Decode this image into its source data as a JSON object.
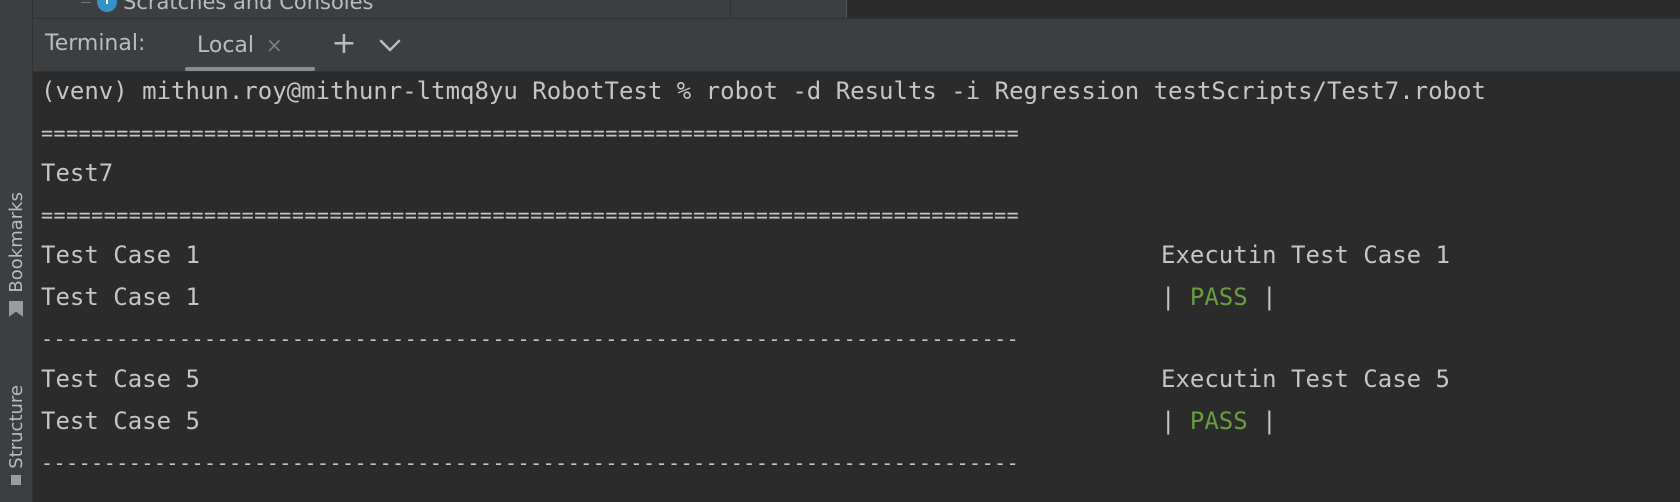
{
  "project_tree": {
    "item_label": "Scratches and Consoles",
    "item_icon": "scratches-clock-icon"
  },
  "left_strip": {
    "bookmarks_label": "Bookmarks",
    "structure_label": "Structure"
  },
  "terminal": {
    "title": "Terminal:",
    "tab_label": "Local",
    "tab_close": "×",
    "add_label": "+",
    "prompt_line": "(venv) mithun.roy@mithunr-ltmq8yu RobotTest % robot -d Results -i Regression testScripts/Test7.robot",
    "separator_double": "==============================================================================",
    "separator_single": "------------------------------------------------------------------------------",
    "suite_name": "Test7",
    "tests": [
      {
        "name": "Test Case 1",
        "log": "Executin Test Case 1",
        "status_prefix": "| ",
        "status": "PASS",
        "status_suffix": " |"
      },
      {
        "name": "Test Case 5",
        "log": "Executin Test Case 5",
        "status_prefix": "| ",
        "status": "PASS",
        "status_suffix": " |"
      }
    ]
  },
  "colors": {
    "background": "#2b2b2b",
    "panel": "#3c3f41",
    "text": "#c5c5c5",
    "pass": "#6a9d3f",
    "accent_icon": "#3592c4"
  }
}
